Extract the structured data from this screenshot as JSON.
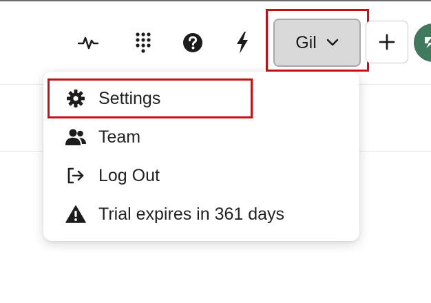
{
  "header": {
    "icons": [
      "activity-icon",
      "dialpad-icon",
      "help-icon",
      "lightning-icon"
    ],
    "user_button": {
      "label": "Gil",
      "icon": "chevron-down-icon"
    },
    "add_button": {
      "icon": "plus-icon"
    },
    "avatar": {
      "color": "#3f7a5f"
    }
  },
  "user_menu": {
    "items": [
      {
        "label": "Settings",
        "icon": "gear-icon"
      },
      {
        "label": "Team",
        "icon": "users-icon"
      },
      {
        "label": "Log Out",
        "icon": "logout-icon"
      },
      {
        "label": "Trial expires in 361 days",
        "icon": "warning-icon"
      }
    ]
  },
  "colors": {
    "highlight": "#c80f14",
    "button_bg": "#d9d9d9",
    "text": "#222222"
  }
}
